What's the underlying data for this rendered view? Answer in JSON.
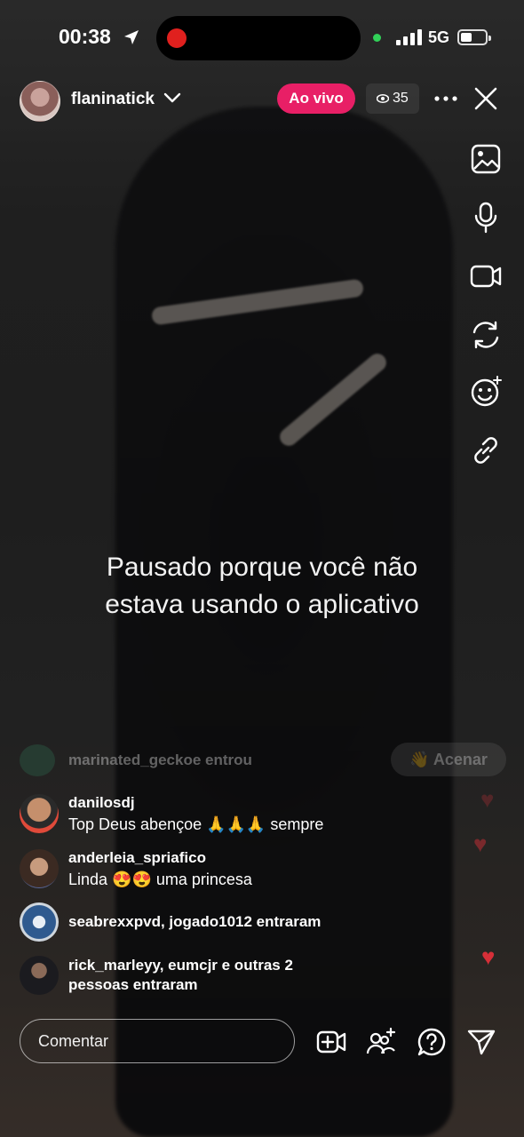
{
  "status_bar": {
    "time": "00:38",
    "network": "5G"
  },
  "header": {
    "username": "flaninatick",
    "live_label": "Ao vivo",
    "viewer_count": "35"
  },
  "overlay": {
    "paused_line1": "Pausado porque você não",
    "paused_line2": "estava usando o aplicativo"
  },
  "comments": {
    "faded_join": {
      "text": "marinated_geckoe entrou",
      "wave_label": "👋 Acenar"
    },
    "items": [
      {
        "name": "danilosdj",
        "message": "Top Deus abençoe 🙏🙏🙏 sempre"
      },
      {
        "name": "anderleia_spriafico",
        "message": "Linda 😍😍 uma princesa"
      },
      {
        "text": "seabrexxpvd, jogado1012 entraram"
      },
      {
        "text_line1": "rick_marleyy, eumcjr e outras 2",
        "text_line2": "pessoas entraram"
      }
    ]
  },
  "bottom": {
    "comment_placeholder": "Comentar"
  },
  "colors": {
    "live_badge": "#e81f66",
    "recording": "#e0201e",
    "heart": "#e0303a"
  }
}
